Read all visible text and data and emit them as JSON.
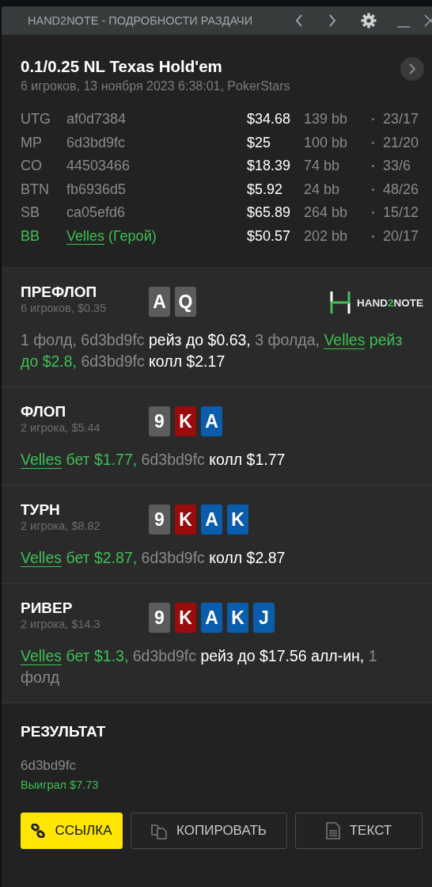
{
  "window": {
    "title": "HAND2NOTE - ПОДРОБНОСТИ РАЗДАЧИ"
  },
  "header": {
    "title": "0.1/0.25 NL Texas Hold'em",
    "subtitle": "6 игроков, 13 ноября 2023 6:38:01, PokerStars"
  },
  "players": [
    {
      "position": "UTG",
      "name": "af0d7384",
      "stack": "$34.68",
      "bb": "139 bb",
      "stats": "23/17",
      "hero": false
    },
    {
      "position": "MP",
      "name": "6d3bd9fc",
      "stack": "$25",
      "bb": "100 bb",
      "stats": "21/20",
      "hero": false
    },
    {
      "position": "CO",
      "name": "44503466",
      "stack": "$18.39",
      "bb": "74 bb",
      "stats": "33/6",
      "hero": false
    },
    {
      "position": "BTN",
      "name": "fb6936d5",
      "stack": "$5.92",
      "bb": "24 bb",
      "stats": "48/26",
      "hero": false
    },
    {
      "position": "SB",
      "name": "ca05efd6",
      "stack": "$65.89",
      "bb": "264 bb",
      "stats": "15/12",
      "hero": false
    },
    {
      "position": "BB",
      "name": "Velles",
      "tag": "(Герой)",
      "stack": "$50.57",
      "bb": "202 bb",
      "stats": "20/17",
      "hero": true
    }
  ],
  "streets": [
    {
      "name": "ПРЕФЛОП",
      "info": "6 игроков, $0.35",
      "logo": {
        "before": "HAND",
        "accent": "2",
        "after": "NOTE"
      },
      "cards": [
        {
          "rank": "A",
          "color": "#5c5c5c"
        },
        {
          "rank": "Q",
          "color": "#5c5c5c"
        }
      ],
      "actions": [
        {
          "kind": "muted",
          "text": "1 фолд, 6d3bd9fc "
        },
        {
          "kind": "bright",
          "text": "рейз до $0.63,"
        },
        {
          "kind": "muted",
          "text": " 3 фолда, "
        },
        {
          "kind": "hero-name",
          "text": "Velles"
        },
        {
          "kind": "hero",
          "text": " рейз до $2.8,"
        },
        {
          "kind": "muted",
          "text": " 6d3bd9fc "
        },
        {
          "kind": "bright",
          "text": "колл $2.17"
        }
      ]
    },
    {
      "name": "ФЛОП",
      "info": "2 игрока, $5.44",
      "cards": [
        {
          "rank": "9",
          "color": "#5c5c5c"
        },
        {
          "rank": "K",
          "color": "#9a0b0b"
        },
        {
          "rank": "A",
          "color": "#0a5cad"
        }
      ],
      "actions": [
        {
          "kind": "hero-name",
          "text": "Velles"
        },
        {
          "kind": "hero",
          "text": " бет $1.77,"
        },
        {
          "kind": "muted",
          "text": " 6d3bd9fc "
        },
        {
          "kind": "bright",
          "text": "колл $1.77"
        }
      ]
    },
    {
      "name": "ТУРН",
      "info": "2 игрока, $8.82",
      "cards": [
        {
          "rank": "9",
          "color": "#5c5c5c"
        },
        {
          "rank": "K",
          "color": "#9a0b0b"
        },
        {
          "rank": "A",
          "color": "#0a5cad"
        },
        {
          "rank": "K",
          "color": "#0a5cad"
        }
      ],
      "actions": [
        {
          "kind": "hero-name",
          "text": "Velles"
        },
        {
          "kind": "hero",
          "text": " бет $2.87,"
        },
        {
          "kind": "muted",
          "text": " 6d3bd9fc "
        },
        {
          "kind": "bright",
          "text": "колл $2.87"
        }
      ]
    },
    {
      "name": "РИВЕР",
      "info": "2 игрока, $14.3",
      "cards": [
        {
          "rank": "9",
          "color": "#5c5c5c"
        },
        {
          "rank": "K",
          "color": "#9a0b0b"
        },
        {
          "rank": "A",
          "color": "#0a5cad"
        },
        {
          "rank": "K",
          "color": "#0a5cad"
        },
        {
          "rank": "J",
          "color": "#0a5cad"
        }
      ],
      "actions": [
        {
          "kind": "hero-name",
          "text": "Velles"
        },
        {
          "kind": "hero",
          "text": " бет $1.3,"
        },
        {
          "kind": "muted",
          "text": " 6d3bd9fc "
        },
        {
          "kind": "bright",
          "text": "рейз до $17.56 алл-ин,"
        },
        {
          "kind": "muted",
          "text": " 1 фолд"
        }
      ]
    }
  ],
  "result": {
    "title": "РЕЗУЛЬТАТ",
    "winner": "6d3bd9fc",
    "outcome": "Выиграл $7.73"
  },
  "buttons": [
    {
      "label": "ССЫЛКА",
      "kind": "link",
      "highlighted": true
    },
    {
      "label": "КОПИРОВАТЬ",
      "kind": "copy",
      "highlighted": false
    },
    {
      "label": "ТЕКСТ",
      "kind": "text",
      "highlighted": false
    }
  ]
}
